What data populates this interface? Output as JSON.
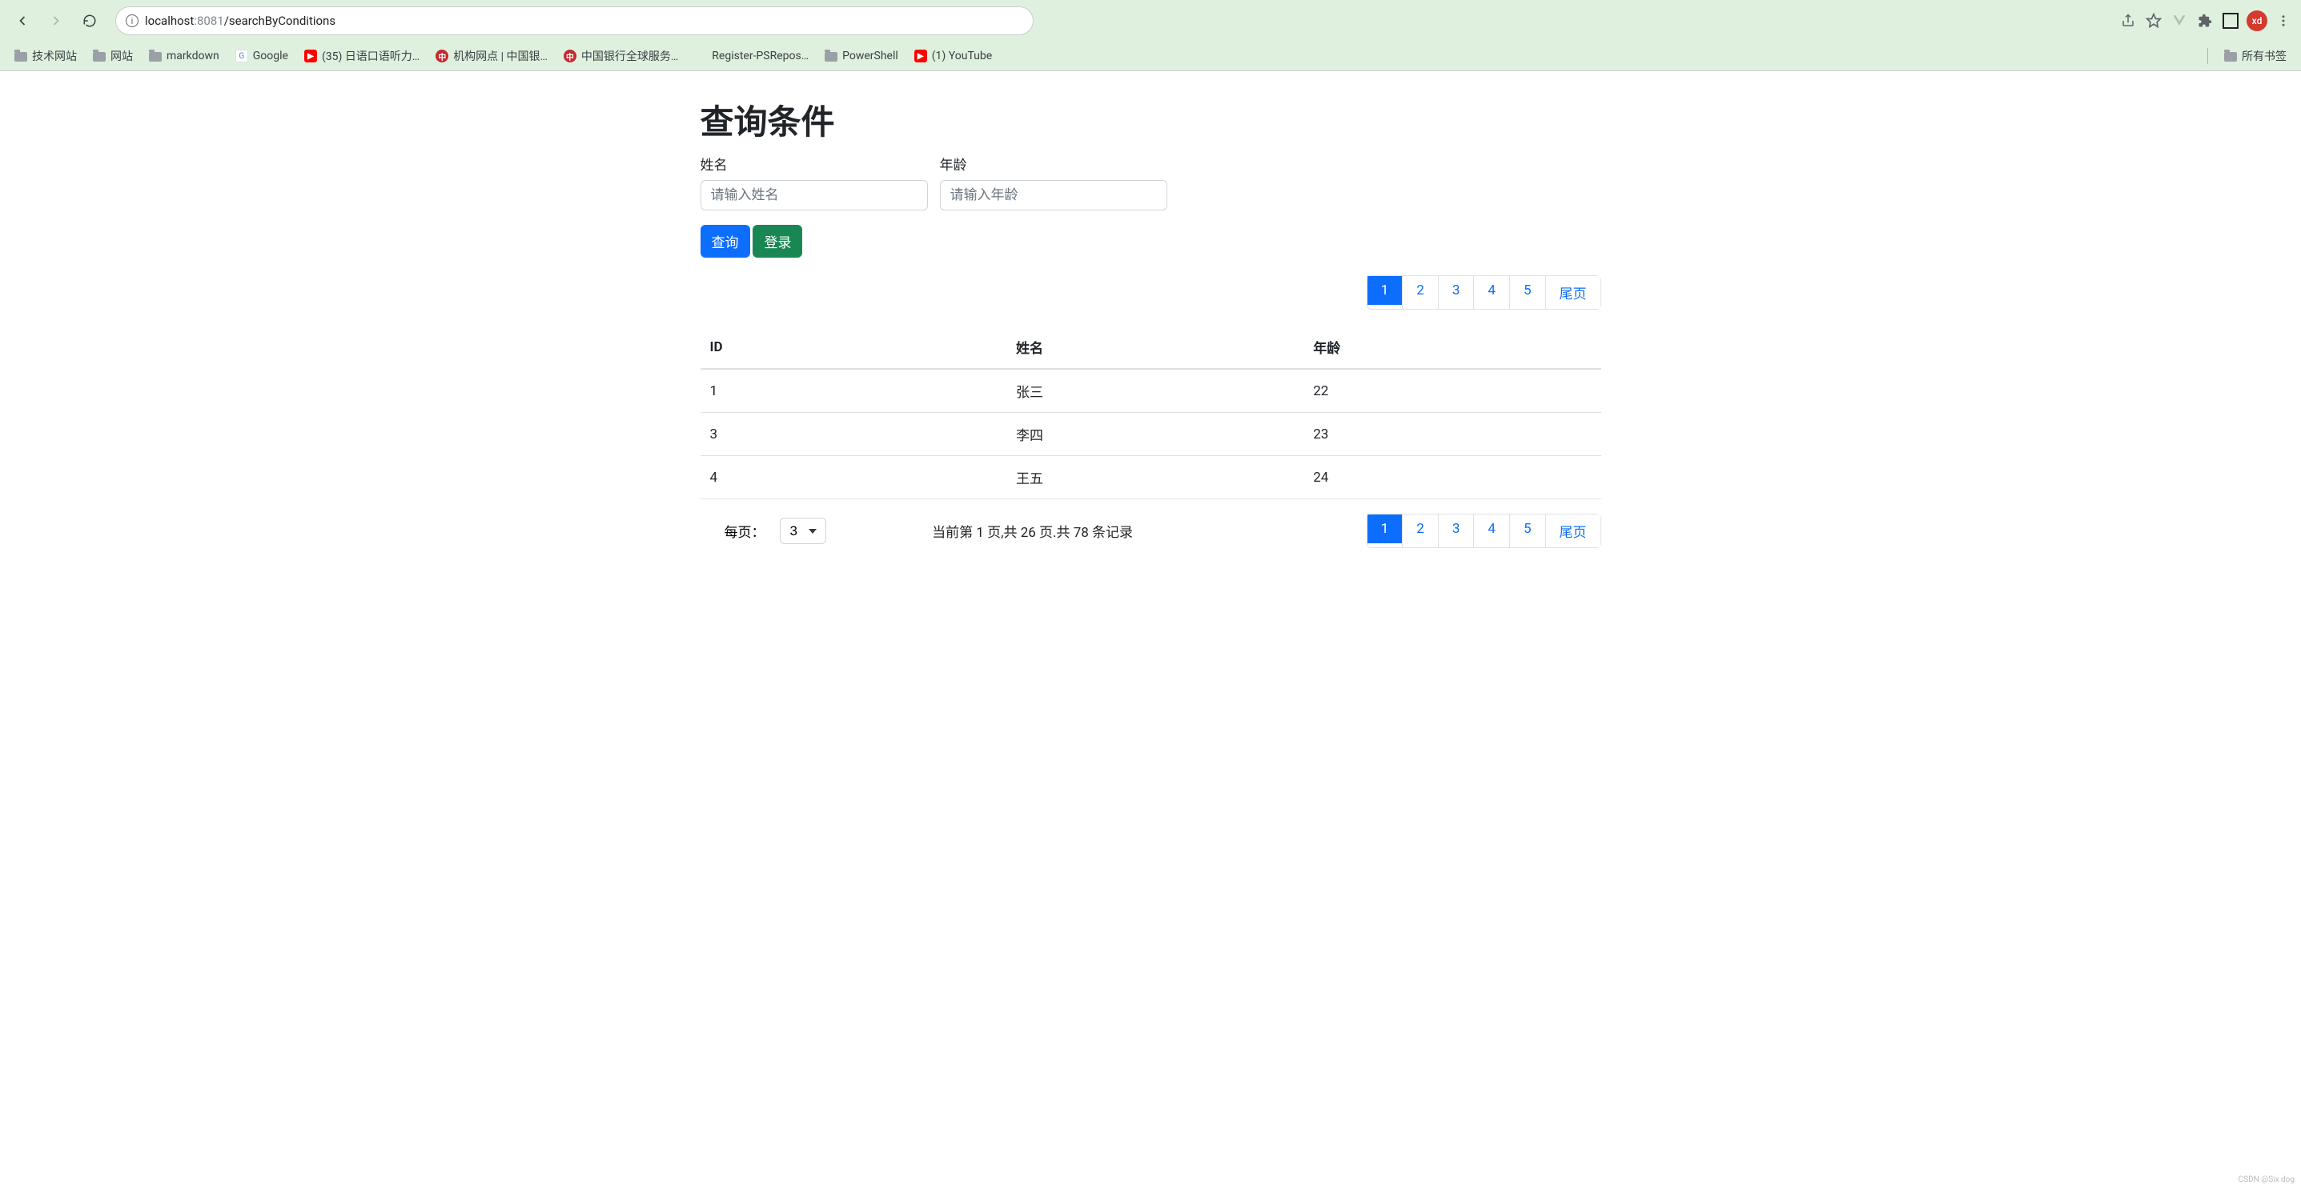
{
  "browser": {
    "url_host": "localhost",
    "url_port": ":8081",
    "url_path": "/searchByConditions",
    "avatar": "xd",
    "bookmarks": [
      {
        "label": "技术网站",
        "kind": "folder"
      },
      {
        "label": "网站",
        "kind": "folder"
      },
      {
        "label": "markdown",
        "kind": "folder"
      },
      {
        "label": "Google",
        "kind": "g"
      },
      {
        "label": "(35) 日语口语听力…",
        "kind": "yt"
      },
      {
        "label": "机构网点 | 中国银…",
        "kind": "red"
      },
      {
        "label": "中国银行全球服务…",
        "kind": "red"
      },
      {
        "label": "Register-PSRepos…",
        "kind": "ms"
      },
      {
        "label": "PowerShell",
        "kind": "folder"
      },
      {
        "label": "(1) YouTube",
        "kind": "yt"
      }
    ],
    "all_bookmarks_label": "所有书签"
  },
  "page": {
    "title": "查询条件",
    "form": {
      "name_label": "姓名",
      "name_placeholder": "请输入姓名",
      "age_label": "年龄",
      "age_placeholder": "请输入年龄",
      "query_button": "查询",
      "login_button": "登录"
    },
    "pagination": {
      "pages": [
        "1",
        "2",
        "3",
        "4",
        "5"
      ],
      "last_label": "尾页",
      "active_index": 0
    },
    "table": {
      "headers": {
        "id": "ID",
        "name": "姓名",
        "age": "年龄"
      },
      "rows": [
        {
          "id": "1",
          "name": "张三",
          "age": "22"
        },
        {
          "id": "3",
          "name": "李四",
          "age": "23"
        },
        {
          "id": "4",
          "name": "王五",
          "age": "24"
        }
      ]
    },
    "footer": {
      "per_page_label": "每页：",
      "per_page_value": "3",
      "info_text": "当前第 1 页,共 26 页.共 78 条记录"
    }
  },
  "watermark": "CSDN @Six dog"
}
